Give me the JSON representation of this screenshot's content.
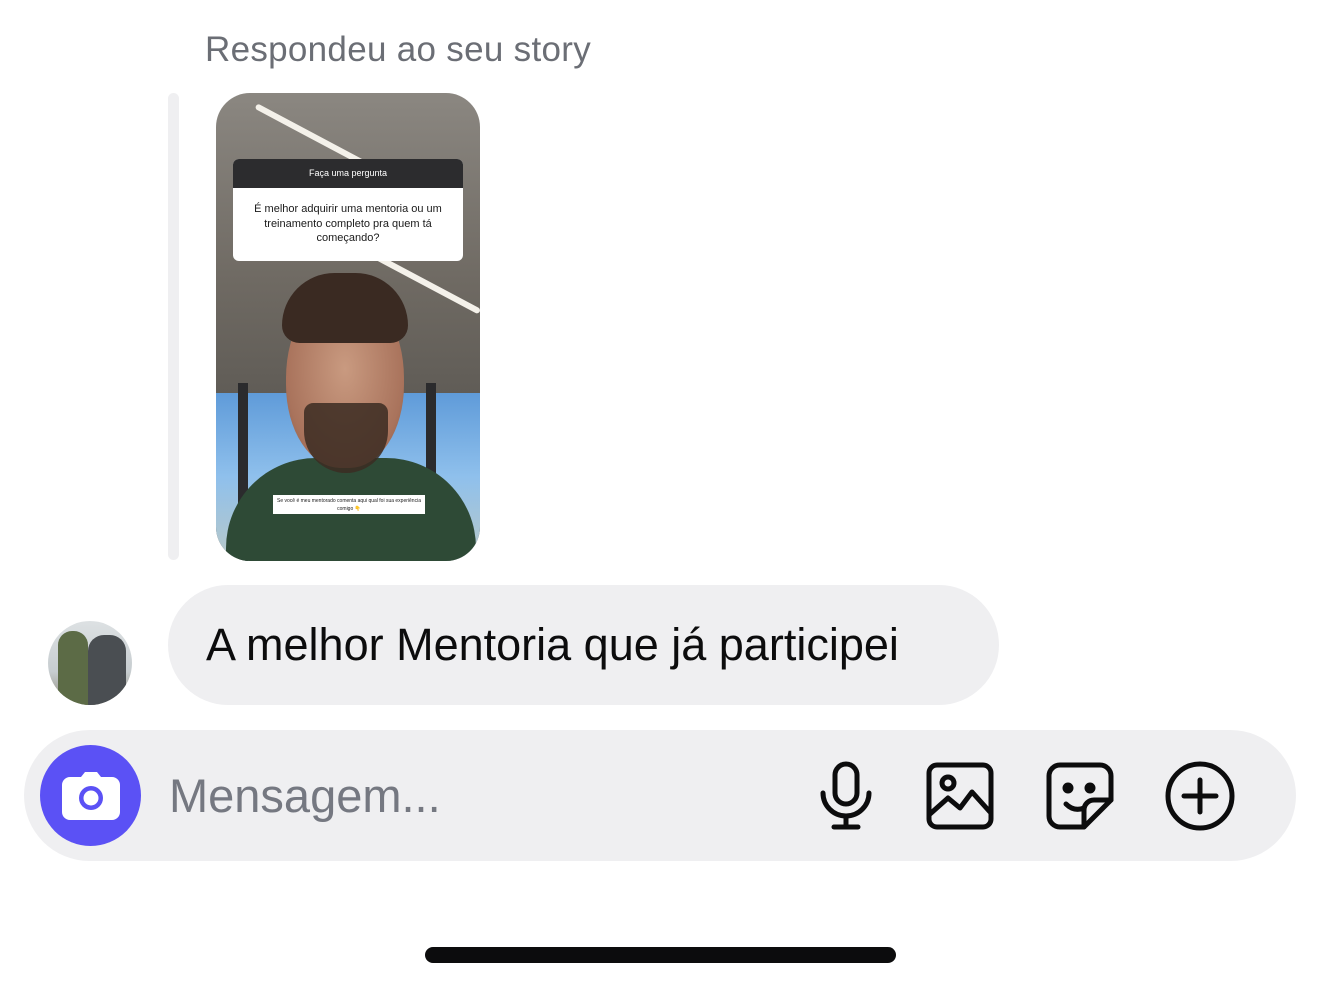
{
  "reply": {
    "header": "Respondeu ao seu story",
    "story": {
      "question_title": "Faça uma pergunta",
      "question_text": "É melhor adquirir uma mentoria ou um treinamento completo pra quem tá começando?",
      "caption": "Se você é meu mentorado comenta aqui qual foi sua experiência comigo 👇"
    }
  },
  "message": {
    "text": "A melhor Mentoria que já participei"
  },
  "composer": {
    "placeholder": "Mensagem...",
    "accent_color": "#5b51f5",
    "tools": [
      "camera-icon",
      "microphone-icon",
      "gallery-icon",
      "sticker-icon",
      "add-icon"
    ]
  }
}
